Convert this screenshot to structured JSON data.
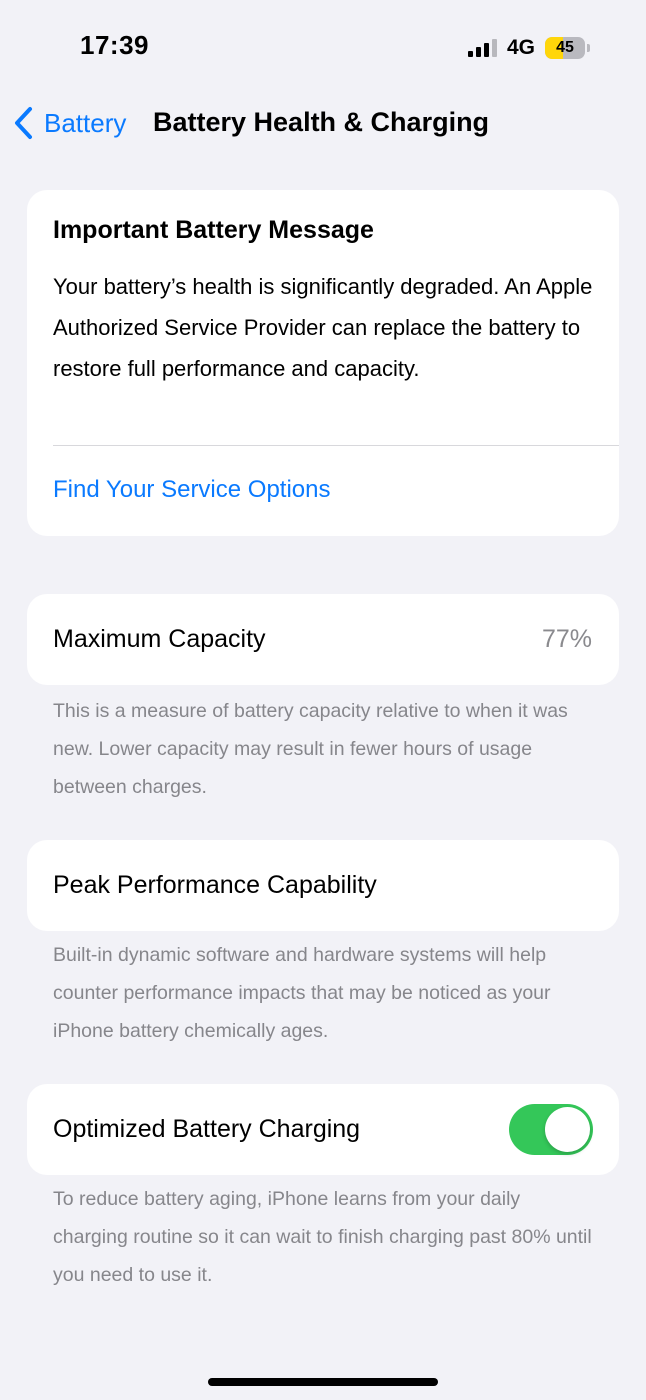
{
  "status_bar": {
    "time": "17:39",
    "network": "4G",
    "battery_level": "45",
    "battery_fraction": 0.45,
    "signal_icon": "cellular-signal-icon",
    "battery_icon": "battery-icon"
  },
  "nav": {
    "back_label": "Battery",
    "back_icon": "chevron-left-icon",
    "title": "Battery Health & Charging"
  },
  "message": {
    "title": "Important Battery Message",
    "body": "Your battery’s health is significantly degraded. An Apple Authorized Service Provider can replace the battery to restore full performance and capacity.",
    "link": "Find Your Service Options"
  },
  "maximum_capacity": {
    "label": "Maximum Capacity",
    "value": "77%",
    "description": "This is a measure of battery capacity relative to when it was new. Lower capacity may result in fewer hours of usage between charges."
  },
  "peak_performance": {
    "label": "Peak Performance Capability",
    "description": "Built-in dynamic software and hardware systems will help counter performance impacts that may be noticed as your iPhone battery chemically ages."
  },
  "optimized_charging": {
    "label": "Optimized Battery Charging",
    "enabled": true,
    "description": "To reduce battery aging, iPhone learns from your daily charging routine so it can wait to finish charging past 80% until you need to use it."
  },
  "colors": {
    "accent": "#0a7aff",
    "toggle_on": "#34c759",
    "background": "#f2f2f7",
    "secondary_text": "#86868b",
    "battery_fill": "#ffd60a"
  }
}
